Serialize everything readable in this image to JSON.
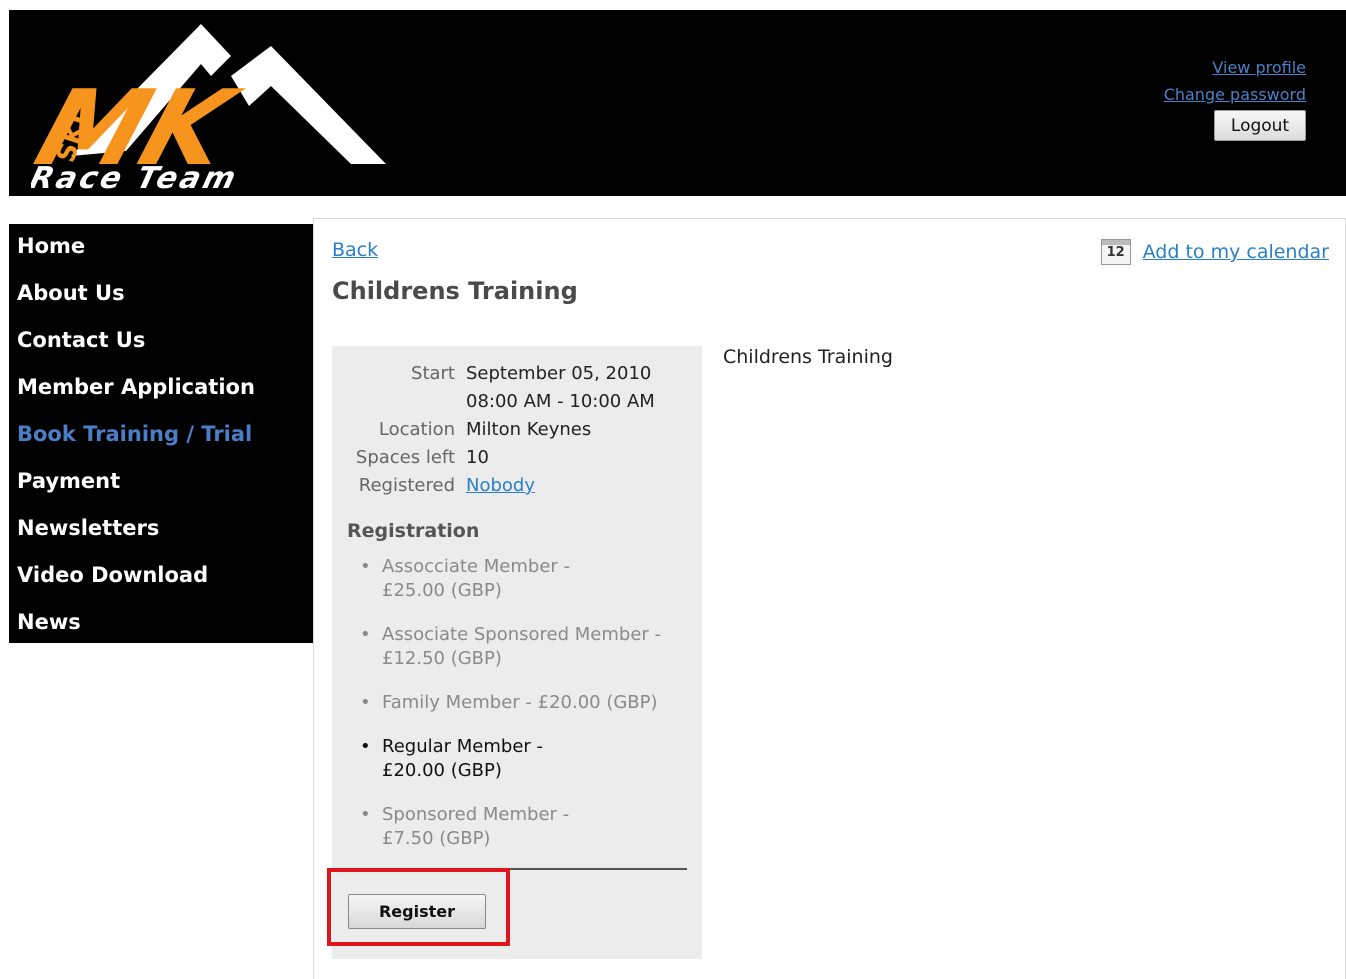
{
  "header": {
    "logo": {
      "text_top": "MK",
      "text_side": "SKI",
      "text_bottom": "Race Team"
    },
    "links": {
      "view_profile": "View profile",
      "change_password": "Change password"
    },
    "logout_label": "Logout"
  },
  "sidebar": {
    "items": [
      {
        "label": "Home"
      },
      {
        "label": "About Us"
      },
      {
        "label": "Contact Us"
      },
      {
        "label": "Member Application"
      },
      {
        "label": "Book Training / Trial",
        "active": true
      },
      {
        "label": "Payment"
      },
      {
        "label": "Newsletters"
      },
      {
        "label": "Video Download"
      },
      {
        "label": "News"
      }
    ]
  },
  "main": {
    "back_label": "Back",
    "calendar": {
      "icon": "calendar-icon",
      "day": "12",
      "label": "Add to my calendar"
    },
    "title": "Childrens Training",
    "details": {
      "start_label": "Start",
      "start_date": "September 05, 2010",
      "start_time": "08:00 AM - 10:00 AM",
      "location_label": "Location",
      "location": "Milton Keynes",
      "spaces_label": "Spaces left",
      "spaces": "10",
      "registered_label": "Registered",
      "registered": "Nobody"
    },
    "registration": {
      "heading": "Registration",
      "options": [
        {
          "line1": "Assocciate Member -",
          "line2": "£25.00 (GBP)"
        },
        {
          "line1": "Associate Sponsored Member -",
          "line2": "£12.50 (GBP)"
        },
        {
          "line1": "Family Member - £20.00 (GBP)",
          "line2": ""
        },
        {
          "line1": "Regular Member -",
          "line2": "£20.00 (GBP)",
          "selected": true
        },
        {
          "line1": "Sponsored Member -",
          "line2": "£7.50 (GBP)"
        }
      ],
      "register_label": "Register"
    },
    "description": "Childrens Training"
  },
  "colors": {
    "header_bg": "#000000",
    "logo_orange": "#f7941d",
    "link": "#2a7fc9",
    "active_nav": "#4a7fc8",
    "panel_bg": "#ececec",
    "highlight": "#e0141b"
  }
}
